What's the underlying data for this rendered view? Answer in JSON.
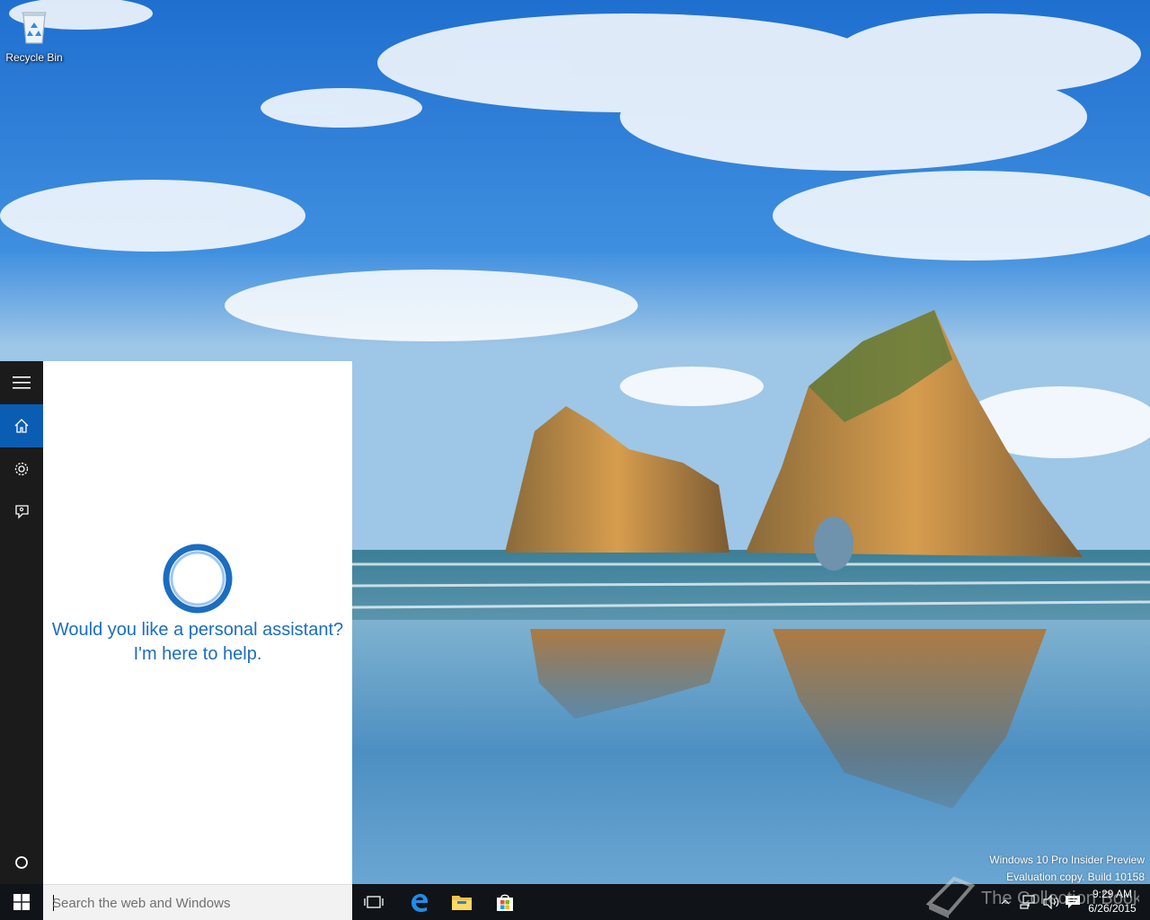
{
  "desktop": {
    "icons": [
      {
        "label": "Recycle Bin",
        "icon": "recycle-bin-icon"
      }
    ],
    "watermark": {
      "line1": "Windows 10 Pro Insider Preview",
      "line2": "Evaluation copy. Build 10158"
    },
    "logo_text": "The Collection Book"
  },
  "cortana": {
    "rail": [
      {
        "name": "menu",
        "icon": "hamburger-icon"
      },
      {
        "name": "home",
        "icon": "home-icon",
        "active": true
      },
      {
        "name": "settings",
        "icon": "gear-icon"
      },
      {
        "name": "feedback",
        "icon": "feedback-icon"
      },
      {
        "name": "cortana",
        "icon": "circle-icon"
      }
    ],
    "prompt": "Would you like a personal assistant? I'm here to help.",
    "accent_color": "#1b6dc1"
  },
  "taskbar": {
    "search_placeholder": "Search the web and Windows",
    "pinned": [
      {
        "name": "task-view",
        "icon": "task-view-icon"
      },
      {
        "name": "edge",
        "icon": "edge-icon"
      },
      {
        "name": "file-explorer",
        "icon": "folder-icon"
      },
      {
        "name": "store",
        "icon": "store-icon"
      }
    ],
    "tray": [
      {
        "name": "show-hidden",
        "icon": "chevron-up-icon"
      },
      {
        "name": "network",
        "icon": "network-icon"
      },
      {
        "name": "volume",
        "icon": "speaker-icon"
      },
      {
        "name": "action-center",
        "icon": "notification-icon"
      }
    ],
    "clock": {
      "time": "9:29 AM",
      "date": "6/26/2015"
    }
  }
}
